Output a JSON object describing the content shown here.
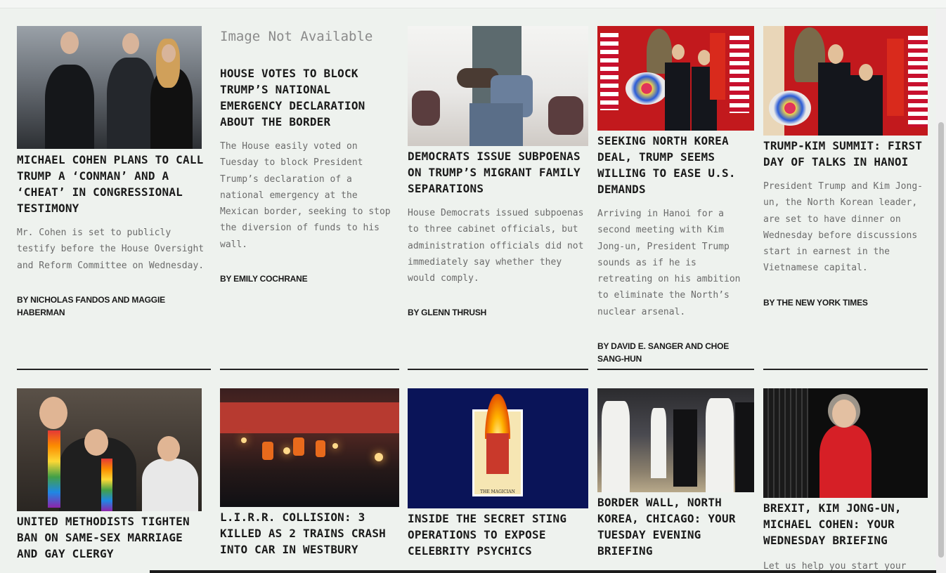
{
  "articles_row1": [
    {
      "headline": "MICHAEL COHEN PLANS TO CALL TRUMP A ‘CONMAN’ AND A ‘CHEAT’ IN CONGRESSIONAL TESTIMONY",
      "summary": "Mr. Cohen is set to publicly testify before the House Oversight and Reform Committee on Wednesday.",
      "byline": "BY NICHOLAS FANDOS AND MAGGIE HABERMAN"
    },
    {
      "image_placeholder": "Image Not Available",
      "headline": "HOUSE VOTES TO BLOCK TRUMP’S NATIONAL EMERGENCY DECLARATION ABOUT THE BORDER",
      "summary": "The House easily voted on Tuesday to block President Trump’s declaration of a national emergency at the Mexican border, seeking to stop the diversion of funds to his wall.",
      "byline": "BY EMILY COCHRANE"
    },
    {
      "headline": "DEMOCRATS ISSUE SUBPOENAS ON TRUMP’S MIGRANT FAMILY SEPARATIONS",
      "summary": "House Democrats issued subpoenas to three cabinet officials, but administration officials did not immediately say whether they would comply.",
      "byline": "BY GLENN THRUSH"
    },
    {
      "headline": "SEEKING NORTH KOREA DEAL, TRUMP SEEMS WILLING TO EASE U.S. DEMANDS",
      "summary": "Arriving in Hanoi for a second meeting with Kim Jong-un, President Trump sounds as if he is retreating on his ambition to eliminate the North’s nuclear arsenal.",
      "byline": "BY DAVID E. SANGER AND CHOE SANG-HUN"
    },
    {
      "headline": "TRUMP-KIM SUMMIT: FIRST DAY OF TALKS IN HANOI",
      "summary": "President Trump and Kim Jong-un, the North Korean leader, are set to have dinner on Wednesday before discussions start in earnest in the Vietnamese capital.",
      "byline": "BY THE NEW YORK TIMES"
    }
  ],
  "articles_row2": [
    {
      "headline": "UNITED METHODISTS TIGHTEN BAN ON SAME-SEX MARRIAGE AND GAY CLERGY"
    },
    {
      "headline": "L.I.R.R. COLLISION: 3 KILLED AS 2 TRAINS CRASH INTO CAR IN WESTBURY"
    },
    {
      "headline": "INSIDE THE SECRET STING OPERATIONS TO EXPOSE CELEBRITY PSYCHICS",
      "image_card_label": "THE MAGICIAN"
    },
    {
      "headline": "BORDER WALL, NORTH KOREA, CHICAGO: YOUR TUESDAY EVENING BRIEFING"
    },
    {
      "headline": "BREXIT, KIM JONG-UN, MICHAEL COHEN: YOUR WEDNESDAY BRIEFING",
      "summary": "Let us help you start your"
    }
  ]
}
